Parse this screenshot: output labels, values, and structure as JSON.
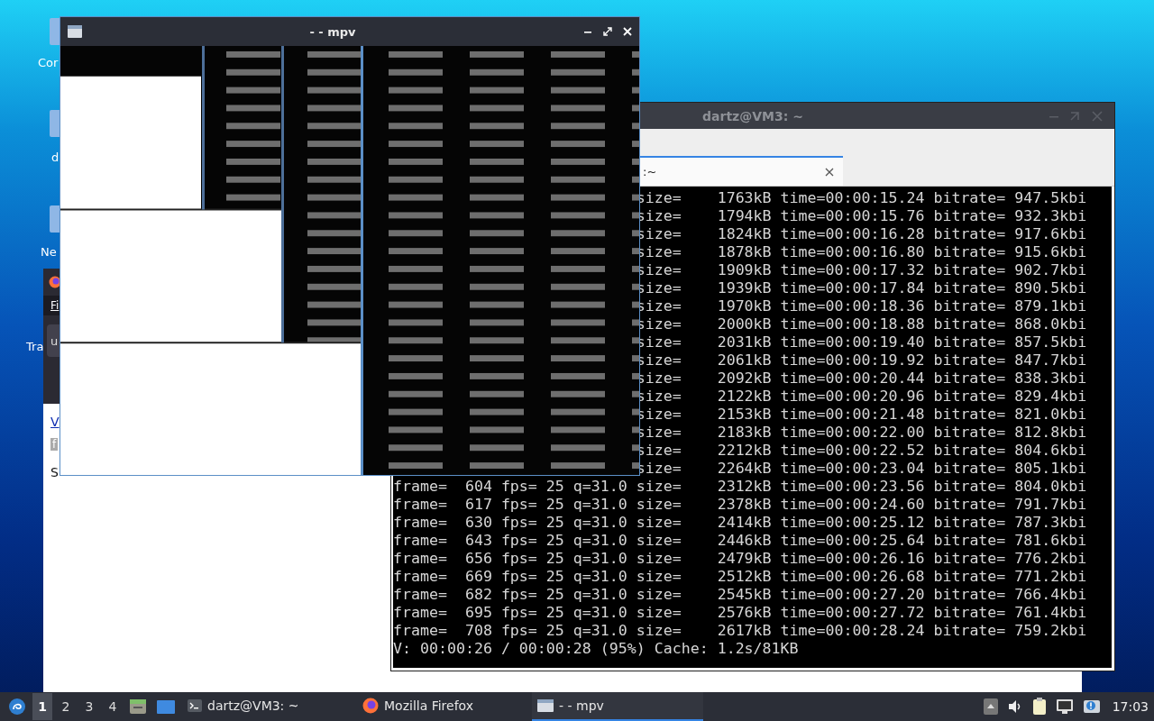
{
  "desktop": {
    "icons": [
      {
        "kind": "with_icon",
        "label": "Cor"
      },
      {
        "kind": "with_icon",
        "label": "d"
      },
      {
        "kind": "with_icon",
        "label": "Ne"
      },
      {
        "kind": "label_only",
        "label": "Tra"
      }
    ]
  },
  "firefox_window": {
    "menu_item": "Fi",
    "url_field": "u",
    "content": [
      {
        "kind": "link",
        "text": "V"
      },
      {
        "kind": "tag",
        "text": "f"
      },
      {
        "kind": "text",
        "text": "S"
      }
    ]
  },
  "terminal_window": {
    "title": "dartz@VM3: ~",
    "tab": {
      "label": ":~"
    },
    "lines": [
      {
        "kind": "partial",
        "text": "size=    1763kB time=00:00:15.24 bitrate= 947.5kbi"
      },
      {
        "kind": "partial",
        "text": "size=    1794kB time=00:00:15.76 bitrate= 932.3kbi"
      },
      {
        "kind": "partial",
        "text": "size=    1824kB time=00:00:16.28 bitrate= 917.6kbi"
      },
      {
        "kind": "partial",
        "text": "size=    1878kB time=00:00:16.80 bitrate= 915.6kbi"
      },
      {
        "kind": "partial",
        "text": "size=    1909kB time=00:00:17.32 bitrate= 902.7kbi"
      },
      {
        "kind": "partial",
        "text": "size=    1939kB time=00:00:17.84 bitrate= 890.5kbi"
      },
      {
        "kind": "partial",
        "text": "size=    1970kB time=00:00:18.36 bitrate= 879.1kbi"
      },
      {
        "kind": "partial",
        "text": "size=    2000kB time=00:00:18.88 bitrate= 868.0kbi"
      },
      {
        "kind": "partial",
        "text": "size=    2031kB time=00:00:19.40 bitrate= 857.5kbi"
      },
      {
        "kind": "partial",
        "text": "size=    2061kB time=00:00:19.92 bitrate= 847.7kbi"
      },
      {
        "kind": "partial",
        "text": "size=    2092kB time=00:00:20.44 bitrate= 838.3kbi"
      },
      {
        "kind": "partial",
        "text": "size=    2122kB time=00:00:20.96 bitrate= 829.4kbi"
      },
      {
        "kind": "partial",
        "text": "size=    2153kB time=00:00:21.48 bitrate= 821.0kbi"
      },
      {
        "kind": "partial",
        "text": "size=    2183kB time=00:00:22.00 bitrate= 812.8kbi"
      },
      {
        "kind": "partial",
        "text": "size=    2212kB time=00:00:22.52 bitrate= 804.6kbi"
      },
      {
        "kind": "partial",
        "text": "size=    2264kB time=00:00:23.04 bitrate= 805.1kbi"
      },
      {
        "kind": "full",
        "text": "frame=  604 fps= 25 q=31.0 size=    2312kB time=00:00:23.56 bitrate= 804.0kbi"
      },
      {
        "kind": "full",
        "text": "frame=  617 fps= 25 q=31.0 size=    2378kB time=00:00:24.60 bitrate= 791.7kbi"
      },
      {
        "kind": "full",
        "text": "frame=  630 fps= 25 q=31.0 size=    2414kB time=00:00:25.12 bitrate= 787.3kbi"
      },
      {
        "kind": "full",
        "text": "frame=  643 fps= 25 q=31.0 size=    2446kB time=00:00:25.64 bitrate= 781.6kbi"
      },
      {
        "kind": "full",
        "text": "frame=  656 fps= 25 q=31.0 size=    2479kB time=00:00:26.16 bitrate= 776.2kbi"
      },
      {
        "kind": "full",
        "text": "frame=  669 fps= 25 q=31.0 size=    2512kB time=00:00:26.68 bitrate= 771.2kbi"
      },
      {
        "kind": "full",
        "text": "frame=  682 fps= 25 q=31.0 size=    2545kB time=00:00:27.20 bitrate= 766.4kbi"
      },
      {
        "kind": "full",
        "text": "frame=  695 fps= 25 q=31.0 size=    2576kB time=00:00:27.72 bitrate= 761.4kbi"
      },
      {
        "kind": "full",
        "text": "frame=  708 fps= 25 q=31.0 size=    2617kB time=00:00:28.24 bitrate= 759.2kbi"
      }
    ],
    "status_line": "V: 00:00:26 / 00:00:28 (95%) Cache: 1.2s/81KB"
  },
  "mpv_window": {
    "title": "- - mpv"
  },
  "taskbar": {
    "workspaces": [
      {
        "label": "1",
        "selected": true
      },
      {
        "label": "2",
        "selected": false
      },
      {
        "label": "3",
        "selected": false
      },
      {
        "label": "4",
        "selected": false
      }
    ],
    "tasks": [
      {
        "kind": "terminal",
        "label": "dartz@VM3: ~",
        "selected": false
      },
      {
        "kind": "browser",
        "label": "Mozilla Firefox",
        "selected": false
      },
      {
        "kind": "player",
        "label": "- - mpv",
        "selected": true
      }
    ],
    "clock": "17:03"
  }
}
